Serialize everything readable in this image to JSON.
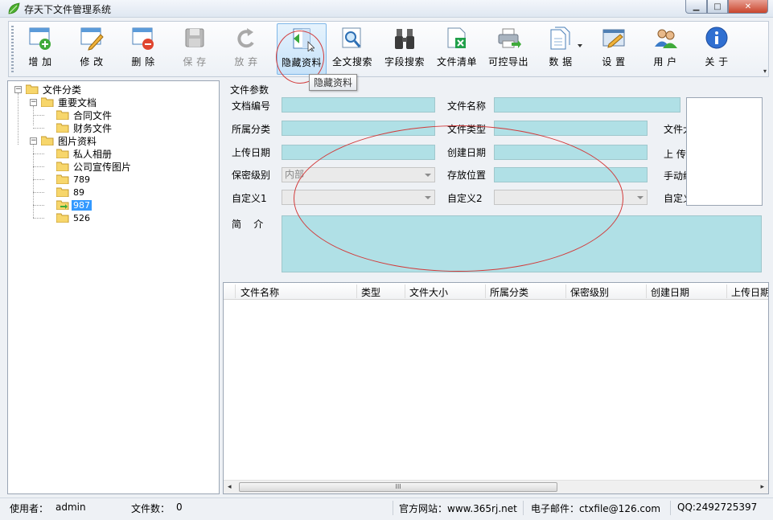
{
  "window": {
    "title": "存天下文件管理系统",
    "min_icon": "minimize-icon",
    "max_icon": "maximize-icon",
    "close_icon": "close-icon",
    "min_glyph": "▁",
    "max_glyph": "□",
    "close_glyph": "✕"
  },
  "toolbar": {
    "buttons": [
      {
        "label": "增 加",
        "icon": "add-document-icon",
        "enabled": true
      },
      {
        "label": "修 改",
        "icon": "edit-document-icon",
        "enabled": true
      },
      {
        "label": "删 除",
        "icon": "delete-document-icon",
        "enabled": true
      },
      {
        "label": "保 存",
        "icon": "save-disk-icon",
        "enabled": false
      },
      {
        "label": "放 弃",
        "icon": "undo-icon",
        "enabled": false
      },
      {
        "label": "隐藏资料",
        "icon": "hide-panel-icon",
        "enabled": true,
        "active": true
      },
      {
        "label": "全文搜索",
        "icon": "magnifier-document-icon",
        "enabled": true
      },
      {
        "label": "字段搜索",
        "icon": "binoculars-icon",
        "enabled": true
      },
      {
        "label": "文件清单",
        "icon": "excel-export-icon",
        "enabled": true
      },
      {
        "label": "可控导出",
        "icon": "printer-export-icon",
        "enabled": true
      },
      {
        "label": "数 据",
        "icon": "documents-icon",
        "enabled": true
      },
      {
        "label": "设 置",
        "icon": "settings-window-icon",
        "enabled": true
      },
      {
        "label": "用 户",
        "icon": "users-icon",
        "enabled": true
      },
      {
        "label": "关 于",
        "icon": "info-icon",
        "enabled": true
      }
    ],
    "tooltip": "隐藏资料",
    "overflow_glyph": "▾"
  },
  "tree": {
    "root": "文件分类",
    "groups": [
      {
        "label": "重要文档",
        "children": [
          "合同文件",
          "财务文件"
        ]
      },
      {
        "label": "图片资料",
        "children": [
          "私人相册",
          "公司宣传图片",
          "789",
          "89",
          "987",
          "526"
        ],
        "selected": "987"
      }
    ],
    "expander_glyph": "−"
  },
  "form": {
    "group_title": "文件参数",
    "labels": {
      "doc_no": "文档编号",
      "file_name": "文件名称",
      "category": "所属分类",
      "file_type": "文件类型",
      "file_size": "文件大小",
      "upload_date": "上传日期",
      "create_date": "创建日期",
      "uploader": "上 传",
      "secret_level": "保密级别",
      "storage": "存放位置",
      "manual": "手动编",
      "custom1": "自定义1",
      "custom2": "自定义2",
      "custom3": "自定义",
      "intro": "简    介"
    },
    "values": {
      "secret_level": "内部"
    }
  },
  "grid": {
    "columns": [
      "文件名称",
      "类型",
      "文件大小",
      "所属分类",
      "保密级别",
      "创建日期",
      "上传日期"
    ],
    "scroll_left": "◂",
    "scroll_right": "▸",
    "thumb_grip": "III"
  },
  "status": {
    "user_label": "使用者：",
    "user_value": "admin",
    "count_label": "文件数：",
    "count_value": "0",
    "website": "官方网站：www.365rj.net",
    "email": "电子邮件：ctxfile@126.com",
    "qq": "QQ:2492725397"
  }
}
